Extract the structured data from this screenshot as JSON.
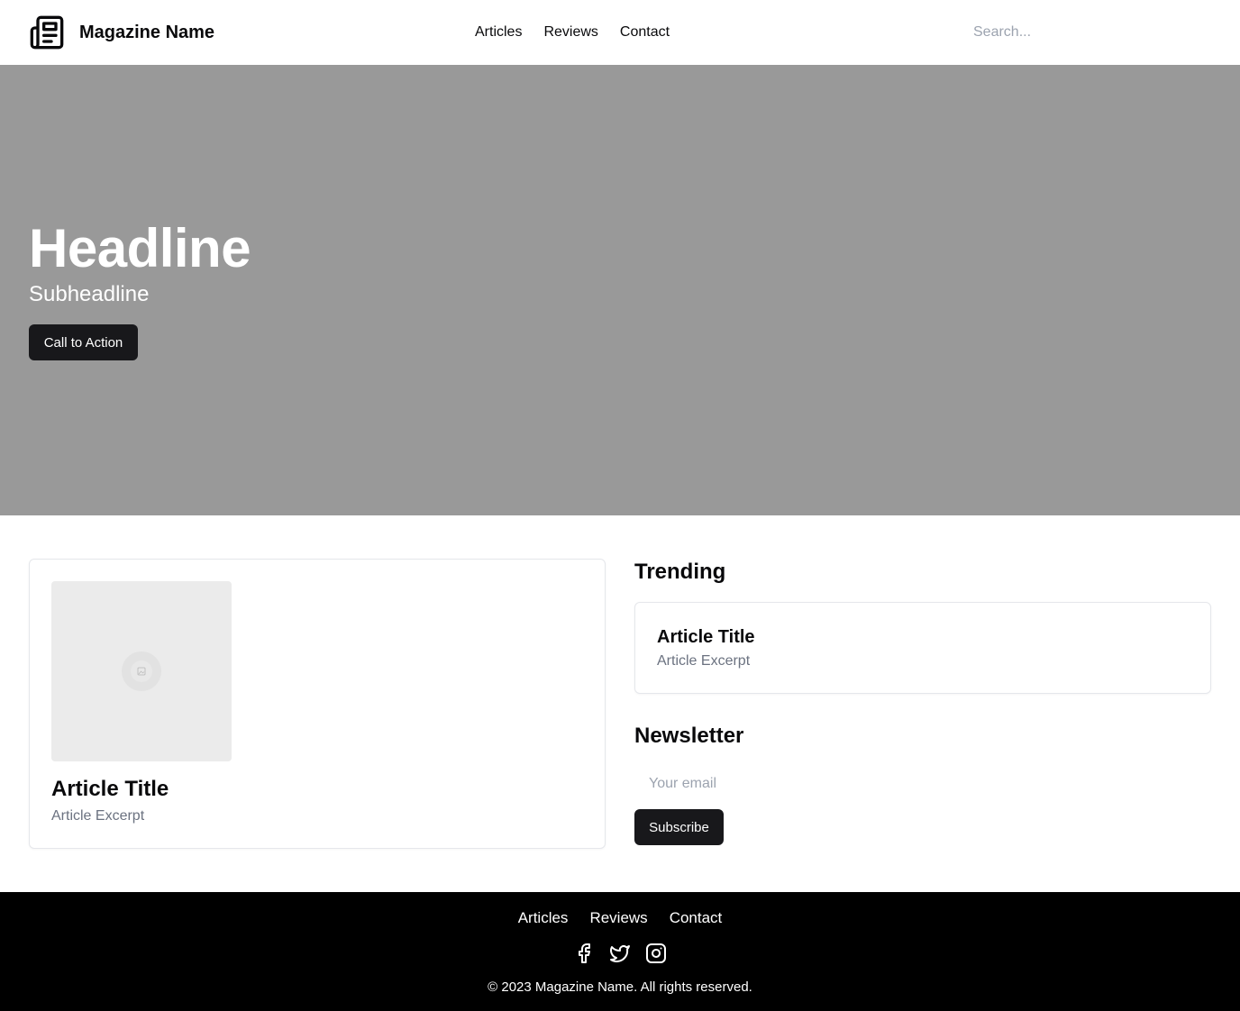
{
  "header": {
    "brand": "Magazine Name",
    "nav": [
      "Articles",
      "Reviews",
      "Contact"
    ],
    "search_placeholder": "Search..."
  },
  "hero": {
    "headline": "Headline",
    "subheadline": "Subheadline",
    "cta_label": "Call to Action",
    "background": "#999999"
  },
  "featured": {
    "title": "Article Title",
    "excerpt": "Article Excerpt",
    "image_icon": "image-placeholder-icon"
  },
  "trending": {
    "heading": "Trending",
    "items": [
      {
        "title": "Article Title",
        "excerpt": "Article Excerpt"
      }
    ]
  },
  "newsletter": {
    "heading": "Newsletter",
    "email_placeholder": "Your email",
    "subscribe_label": "Subscribe"
  },
  "footer": {
    "nav": [
      "Articles",
      "Reviews",
      "Contact"
    ],
    "social_icons": [
      "facebook-icon",
      "twitter-icon",
      "instagram-icon"
    ],
    "copyright": "© 2023 Magazine Name. All rights reserved."
  },
  "colors": {
    "button": "#18181b",
    "muted_text": "#6b7280",
    "footer_bg": "#000000"
  }
}
